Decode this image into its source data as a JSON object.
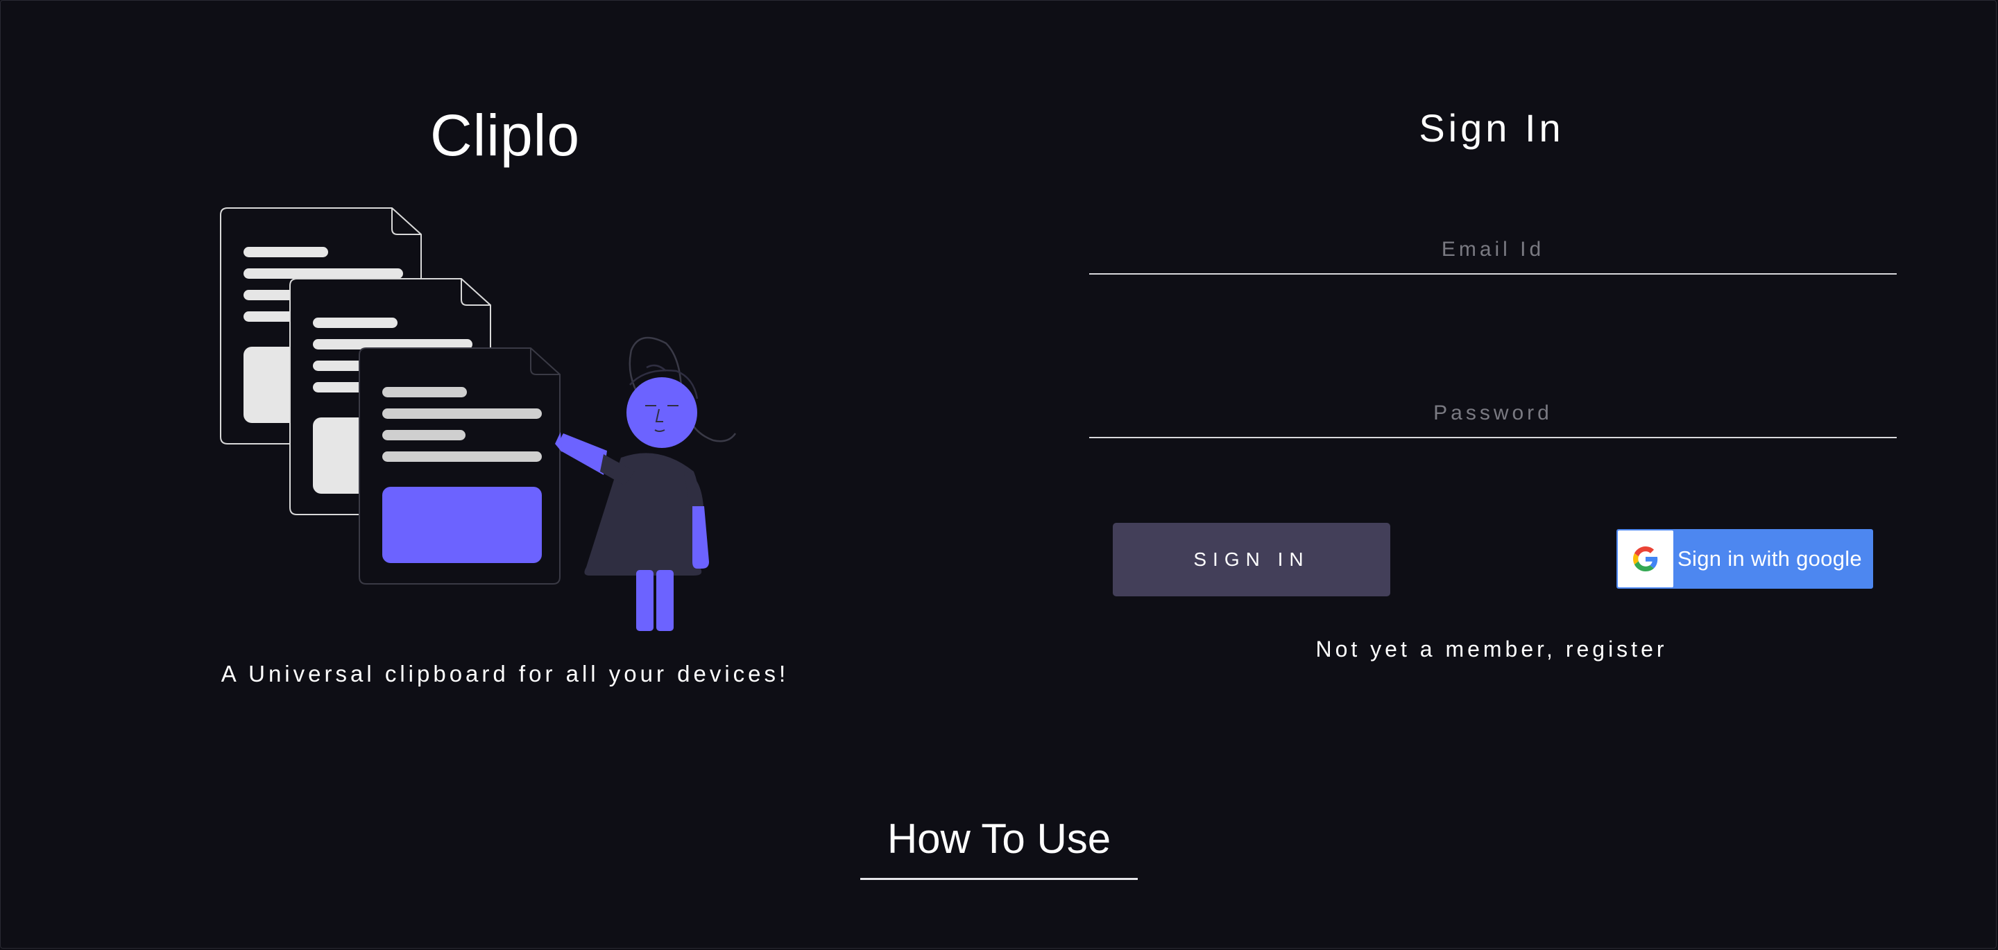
{
  "app": {
    "title": "Cliplo",
    "tagline": "A Universal clipboard for all your devices!"
  },
  "illustration": {
    "name": "documents-and-person-illustration",
    "accent_color": "#6c63ff",
    "doc_line_color": "#e6e6e6",
    "figure_body_color": "#2f2e41"
  },
  "signin": {
    "title": "Sign In",
    "email_placeholder": "Email Id",
    "password_placeholder": "Password",
    "signin_label": "SIGN IN",
    "google_label": "Sign in with google",
    "register_text": "Not yet a member, register"
  },
  "section": {
    "how_to_use": "How To Use"
  },
  "colors": {
    "background": "#0e0e15",
    "signin_button": "#433f59",
    "google_button": "#4d87f0",
    "text": "#ffffff"
  },
  "icons": {
    "google": "google-g-icon"
  }
}
